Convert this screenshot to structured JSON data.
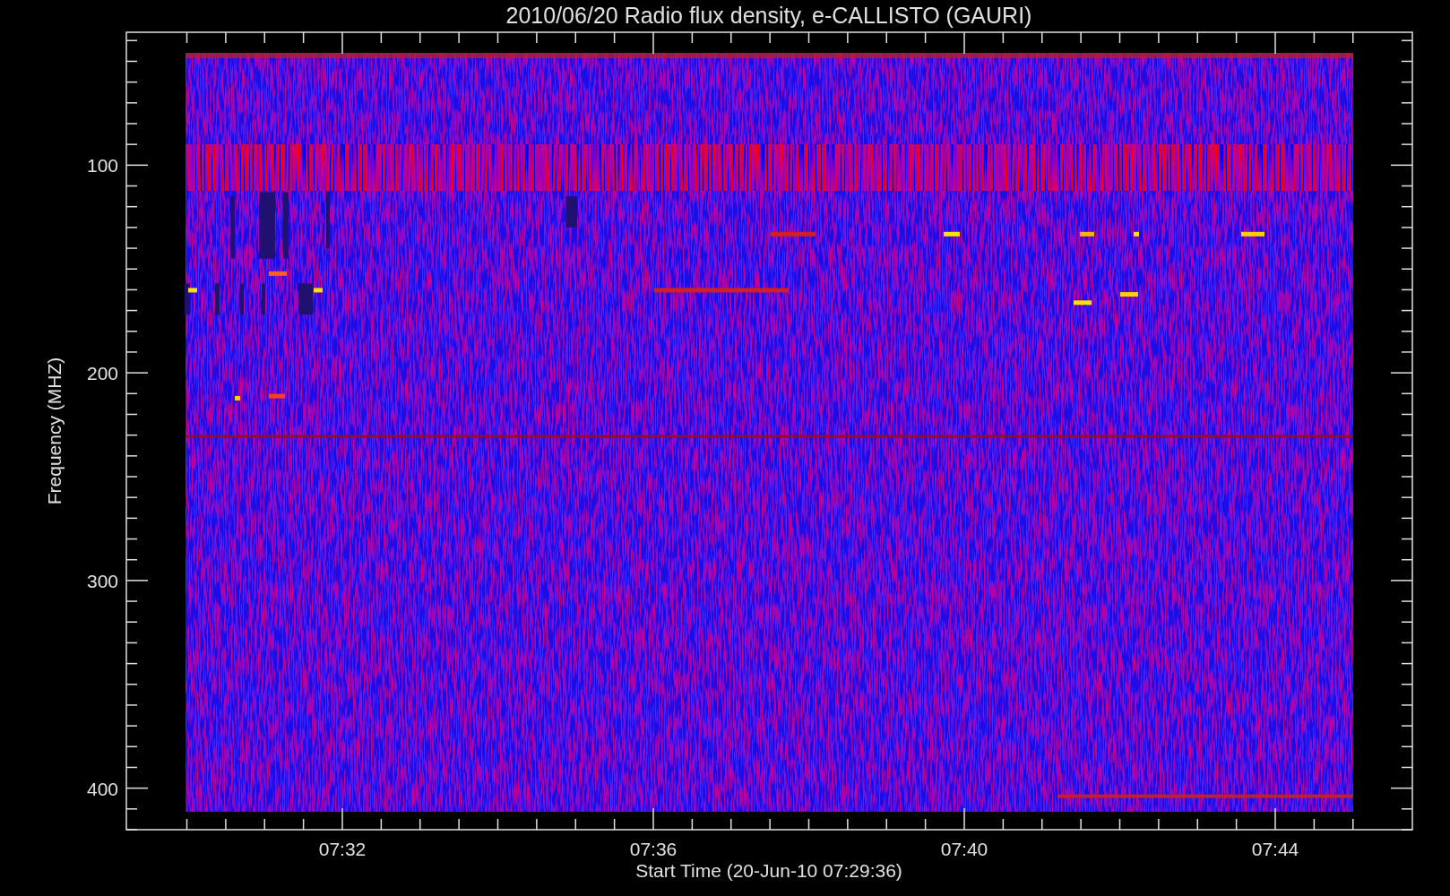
{
  "title": "2010/06/20  Radio flux density, e-CALLISTO (GAURI)",
  "y_axis": {
    "label": "Frequency (MHZ)",
    "ticks": [
      "100",
      "200",
      "300",
      "400"
    ]
  },
  "x_axis": {
    "label": "Start Time (20-Jun-10 07:29:36)",
    "ticks": [
      "07:32",
      "07:36",
      "07:40",
      "07:44"
    ]
  }
}
